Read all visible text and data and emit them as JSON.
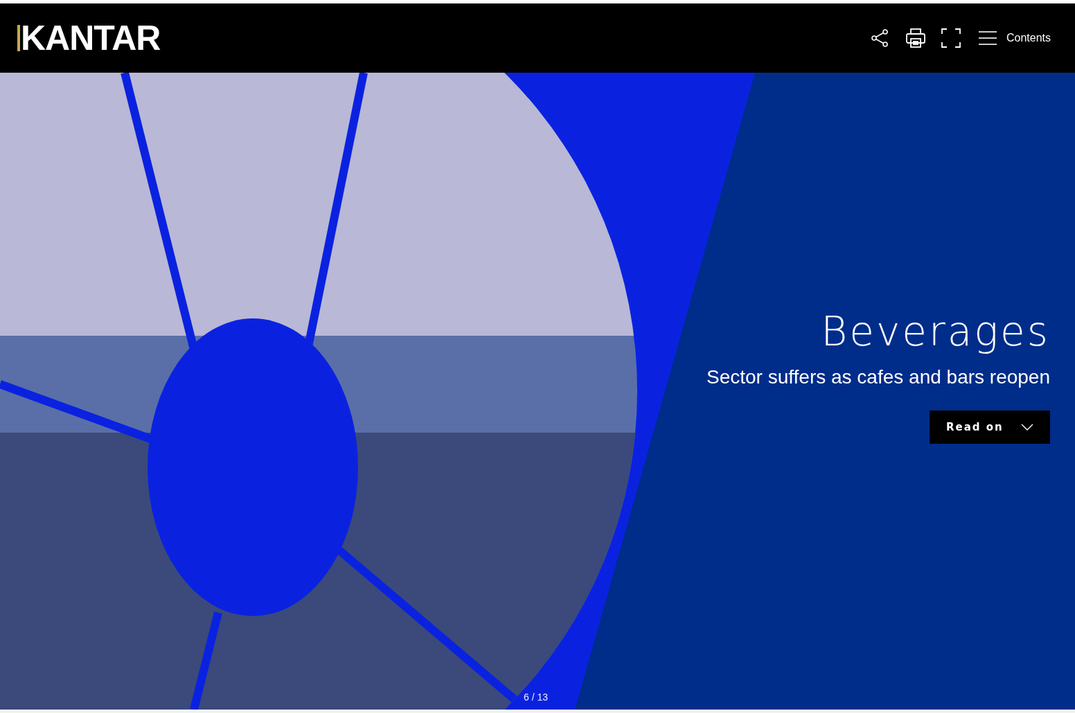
{
  "header": {
    "logo": "KANTAR",
    "contents_label": "Contents"
  },
  "hero": {
    "title": "Beverages",
    "subtitle": "Sector suffers as cafes and bars reopen",
    "button": "Read on",
    "page_indicator": "6 / 13"
  }
}
